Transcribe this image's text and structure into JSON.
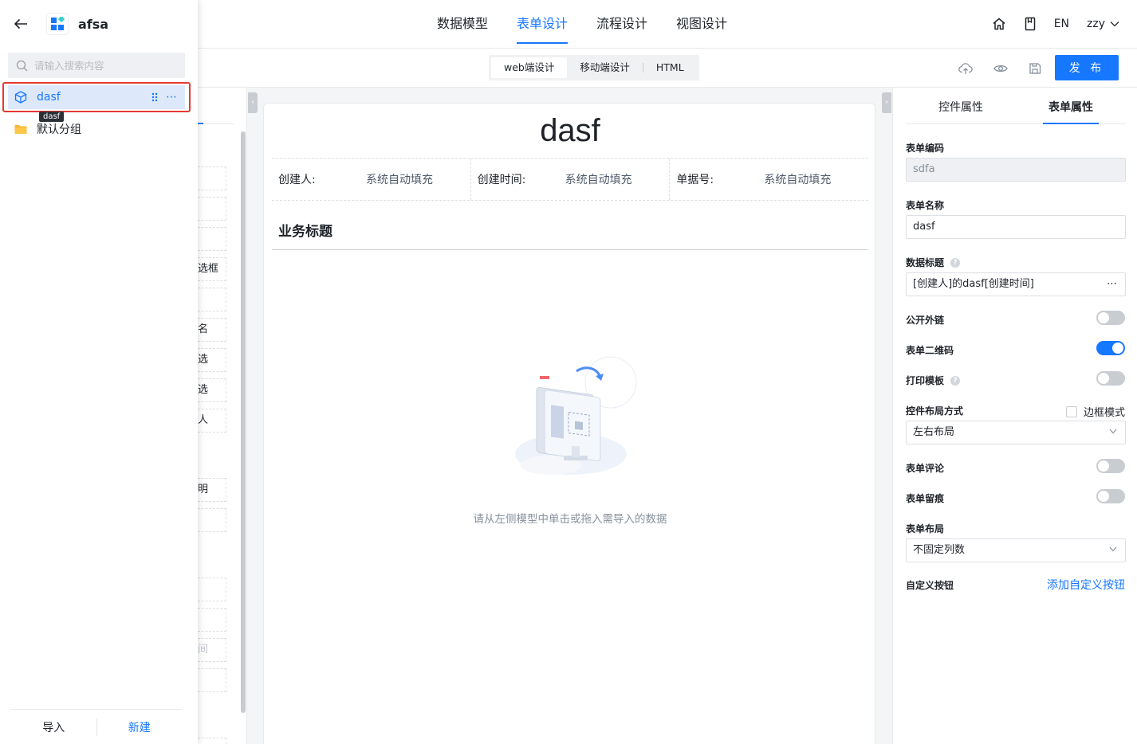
{
  "app": {
    "name": "afsa"
  },
  "topnav": {
    "tabs": [
      {
        "label": "数据模型"
      },
      {
        "label": "表单设计",
        "active": true
      },
      {
        "label": "流程设计"
      },
      {
        "label": "视图设计"
      }
    ],
    "lang": "EN",
    "user": "zzy"
  },
  "toolbar": {
    "modes": [
      "web端设计",
      "移动端设计",
      "HTML"
    ],
    "active_mode": "web端设计",
    "publish_label": "发 布"
  },
  "drawer": {
    "search_placeholder": "请输入搜索内容",
    "items": [
      {
        "label": "dasf",
        "selected": true,
        "icon": "cube-icon"
      },
      {
        "label": "默认分组",
        "icon": "folder-icon"
      }
    ],
    "tooltip": "dasf",
    "footer": {
      "import_label": "导入",
      "new_label": "新建"
    }
  },
  "components": {
    "items": [
      "选框",
      "名",
      "选",
      "选",
      "人",
      "明",
      "间"
    ]
  },
  "form": {
    "title": "dasf",
    "meta": [
      {
        "key": "创建人:",
        "value": "系统自动填充"
      },
      {
        "key": "创建时间:",
        "value": "系统自动填充"
      },
      {
        "key": "单据号:",
        "value": "系统自动填充"
      }
    ],
    "business_title": "业务标题",
    "empty_hint": "请从左侧模型中单击或拖入需导入的数据"
  },
  "props": {
    "tabs": [
      "控件属性",
      "表单属性"
    ],
    "active_tab": "表单属性",
    "form_code_label": "表单编码",
    "form_code_value": "sdfa",
    "form_name_label": "表单名称",
    "form_name_value": "dasf",
    "data_title_label": "数据标题",
    "data_title_value": "[创建人]的dasf[创建时间]",
    "public_link_label": "公开外链",
    "public_link_on": false,
    "qrcode_label": "表单二维码",
    "qrcode_on": true,
    "print_label": "打印模板",
    "print_on": false,
    "layout_mode_label": "控件布局方式",
    "border_mode_label": "边框模式",
    "layout_mode_value": "左右布局",
    "comment_label": "表单评论",
    "comment_on": false,
    "trace_label": "表单留痕",
    "trace_on": false,
    "form_layout_label": "表单布局",
    "form_layout_value": "不固定列数",
    "custom_btn_label": "自定义按钮",
    "custom_btn_link": "添加自定义按钮"
  },
  "colors": {
    "accent": "#1677ff",
    "highlight": "#e53935"
  }
}
